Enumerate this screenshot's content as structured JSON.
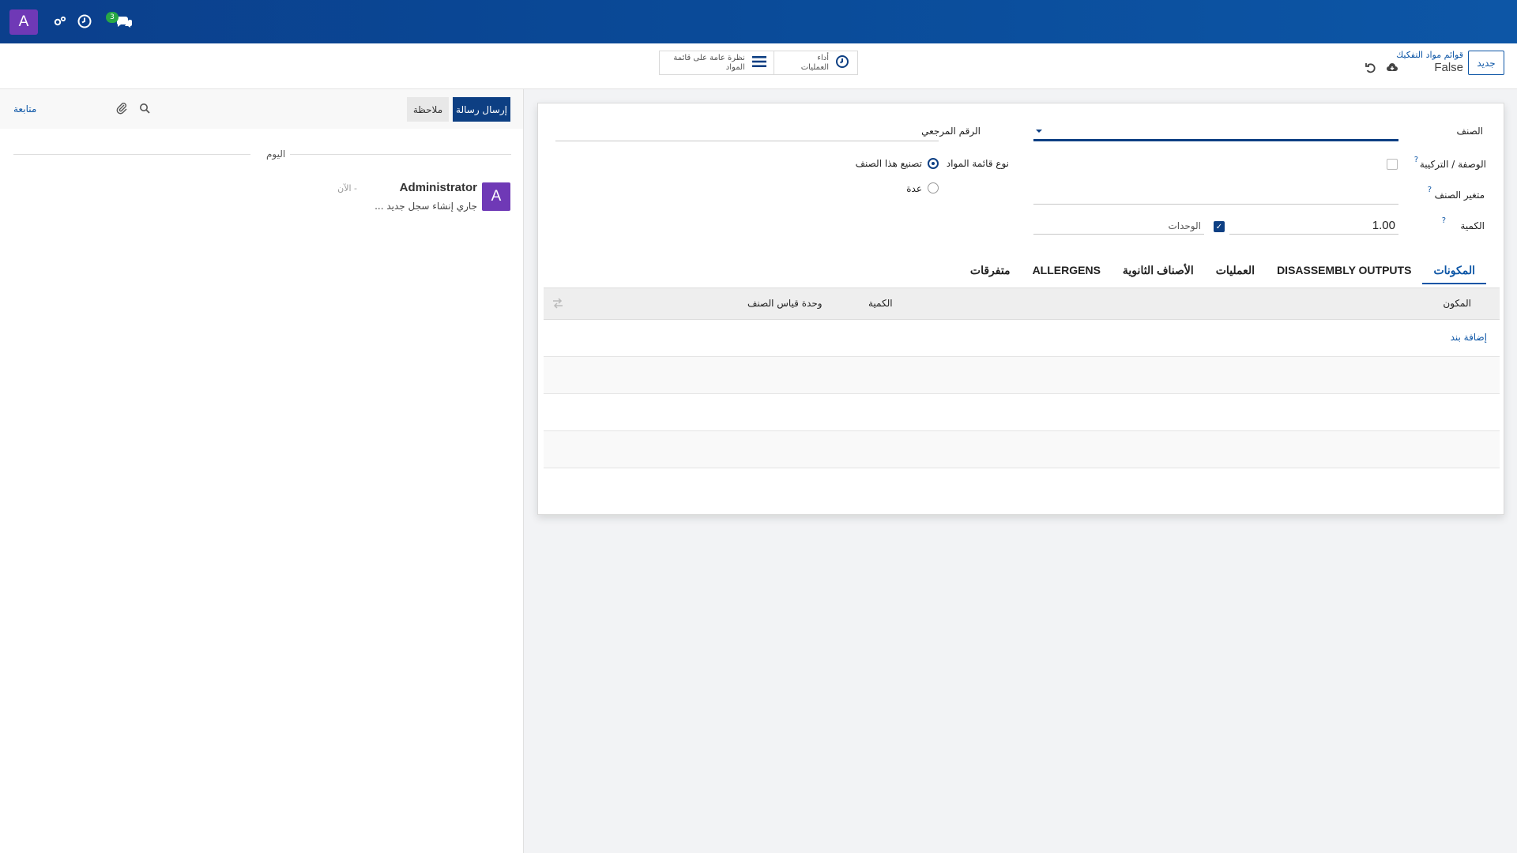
{
  "navbar": {
    "avatar_letter": "A",
    "chat_badge": "3"
  },
  "control_panel": {
    "new_button": "جديد",
    "breadcrumb_parent": "قوائم مواد التفكيك",
    "breadcrumb_current": "False",
    "smart_overview": "نظرة عامة على قائمة المواد",
    "smart_operations_line1": "أداء",
    "smart_operations_line2": "العمليات"
  },
  "form": {
    "product_label": "الصنف",
    "reference_label": "الرقم المرجعي",
    "recipe_label": "الوصفة / التركيبة",
    "variant_label": "متغير الصنف",
    "quantity_label": "الكمية",
    "quantity_value": "1.00",
    "uom_value": "الوحدات",
    "bom_type_label": "نوع قائمة المواد",
    "bom_type_options": [
      "تصنيع هذا الصنف",
      "عدة"
    ],
    "help_mark": "?"
  },
  "tabs": [
    "المكونات",
    "DISASSEMBLY OUTPUTS",
    "العمليات",
    "الأصناف الثانوية",
    "ALLERGENS",
    "متفرقات"
  ],
  "components_table": {
    "columns": [
      "المكون",
      "الكمية",
      "وحدة قياس الصنف"
    ],
    "add_line": "إضافة بند"
  },
  "chatter": {
    "send_message": "إرسال رسالة",
    "log_note": "ملاحظة",
    "follow": "متابعة",
    "day_separator": "اليوم",
    "message": {
      "avatar_letter": "A",
      "author": "Administrator",
      "date": "- الآن",
      "body": "جاري إنشاء سجل جديد ..."
    }
  }
}
